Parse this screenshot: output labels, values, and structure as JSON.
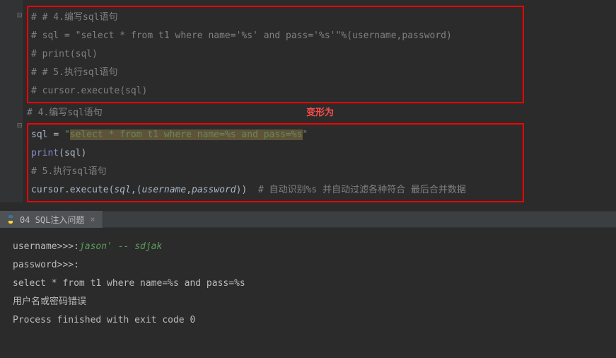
{
  "editor": {
    "block1": {
      "l1": "# # 4.编写sql语句",
      "l2": "# sql = \"select * from t1 where name='%s' and pass='%s'\"%(username,password)",
      "l3": "# print(sql)",
      "l4": "# # 5.执行sql语句",
      "l5": "# cursor.execute(sql)"
    },
    "transform_label": "变形为",
    "between": "# 4.编写sql语句",
    "block2": {
      "sql_var": "sql ",
      "eq": "= ",
      "q1": "\"",
      "sql_str": "select * from t1 where name=%s and pass=%s",
      "q2": "\"",
      "print_fn": "print",
      "lp": "(",
      "sql_arg": "sql",
      "rp": ")",
      "l3": "# 5.执行sql语句",
      "cursor": "cursor",
      "dot": ".",
      "execute": "execute",
      "args_open": "(",
      "sql_p": "sql",
      "comma1": ",",
      "tuple_open": "(",
      "username": "username",
      "comma2": ",",
      "password": "password",
      "tuple_close": ")",
      "args_close": ")",
      "trailing_comment": "  # 自动识别%s 并自动过滤各种符合 最后合并数据"
    }
  },
  "tab": {
    "title": "04 SQL注入问题",
    "close": "×"
  },
  "console": {
    "l1_prompt": "username>>>:",
    "l1_input": "jason' -- sdjak",
    "l2": "password>>>:",
    "l3": "select * from t1 where name=%s and pass=%s",
    "l4": "用户名或密码错误",
    "l5": "",
    "l6": "Process finished with exit code 0"
  }
}
